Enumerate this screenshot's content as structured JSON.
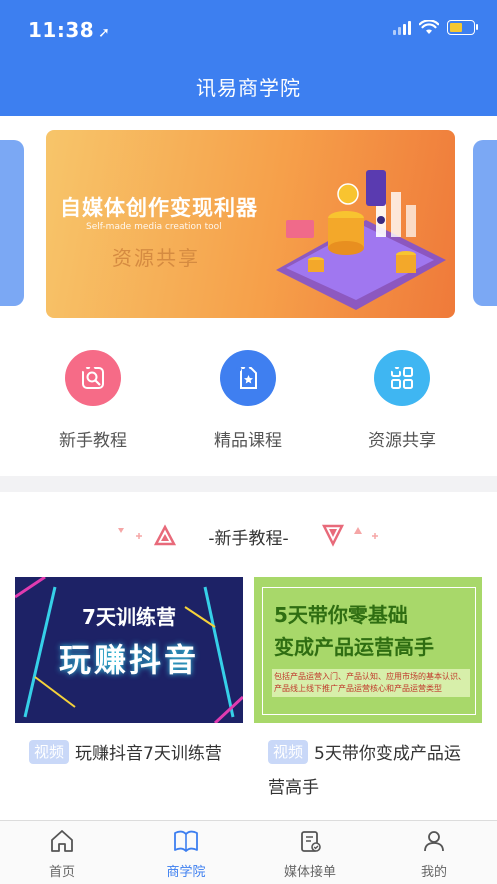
{
  "status": {
    "time": "11:38"
  },
  "header": {
    "title": "讯易商学院"
  },
  "banner": {
    "title": "自媒体创作变现利器",
    "subtitle": "Self-made media creation tool",
    "tag": "资源共享"
  },
  "quick_nav": [
    {
      "label": "新手教程",
      "icon": "compass-icon",
      "color": "#f66b87"
    },
    {
      "label": "精品课程",
      "icon": "star-doc-icon",
      "color": "#3f7ff0"
    },
    {
      "label": "资源共享",
      "icon": "grid-icon",
      "color": "#3fb6f2"
    }
  ],
  "section": {
    "title": "-新手教程-"
  },
  "courses": [
    {
      "tag": "视频",
      "title": "玩赚抖音7天训练营",
      "thumb_line1": "7天训练营",
      "thumb_line2": "玩赚抖音"
    },
    {
      "tag": "视频",
      "title": "5天带你变成产品运营高手",
      "thumb_line1": "5天带你零基础",
      "thumb_line2": "变成产品运营高手",
      "thumb_note": "包括产品运营入门、产品认知、应用市场的基本认识、产品线上线下推广产品运营核心和产品运营类型"
    }
  ],
  "tabbar": [
    {
      "label": "首页",
      "icon": "home-icon",
      "active": false
    },
    {
      "label": "商学院",
      "icon": "book-icon",
      "active": true
    },
    {
      "label": "媒体接单",
      "icon": "clipboard-icon",
      "active": false
    },
    {
      "label": "我的",
      "icon": "user-icon",
      "active": false
    }
  ],
  "colors": {
    "primary": "#3d7ff0",
    "active_tab": "#3d7ff0"
  }
}
